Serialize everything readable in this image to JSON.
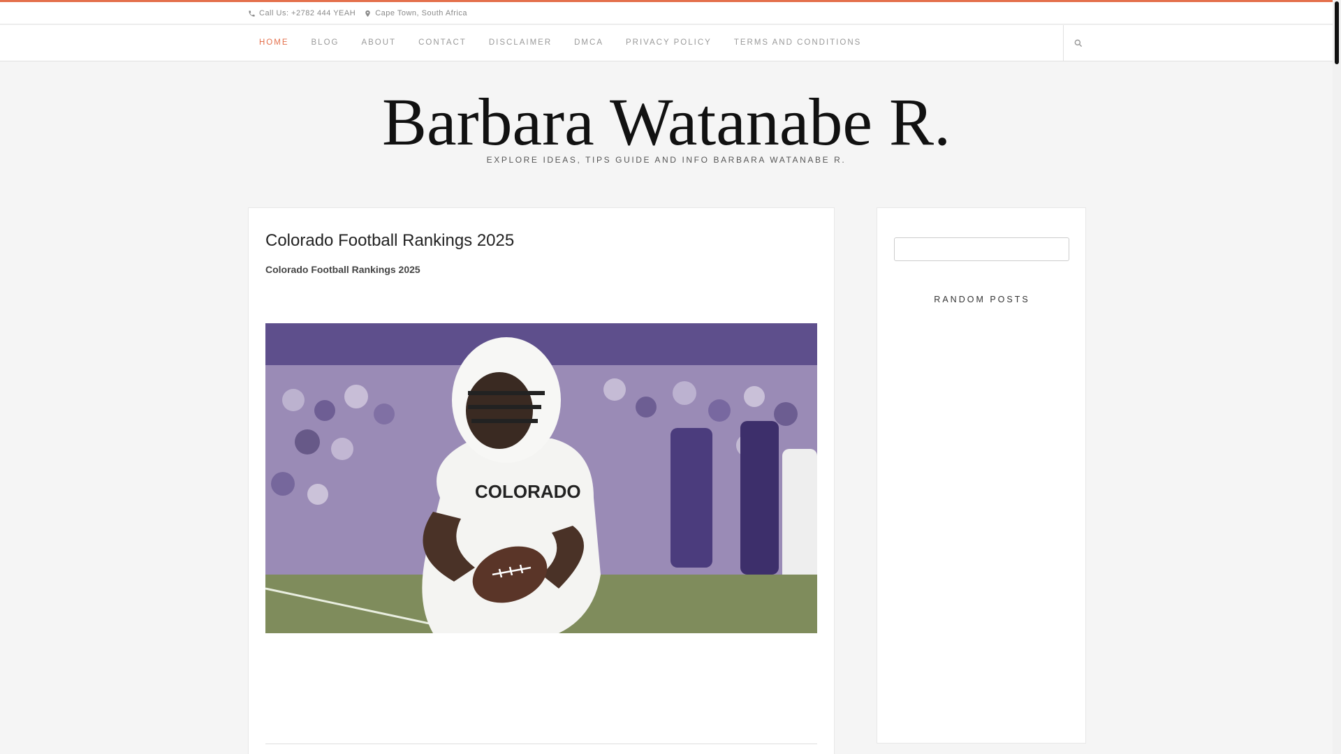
{
  "topbar": {
    "phone": "Call Us: +2782 444 YEAH",
    "location": "Cape Town, South Africa"
  },
  "nav": {
    "items": [
      {
        "label": "HOME",
        "active": true
      },
      {
        "label": "BLOG"
      },
      {
        "label": "ABOUT"
      },
      {
        "label": "CONTACT"
      },
      {
        "label": "DISCLAIMER"
      },
      {
        "label": "DMCA"
      },
      {
        "label": "PRIVACY POLICY"
      },
      {
        "label": "TERMS AND CONDITIONS"
      }
    ],
    "search_icon": "search-icon"
  },
  "header": {
    "title": "Barbara Watanabe R.",
    "tagline": "EXPLORE IDEAS, TIPS GUIDE AND INFO BARBARA WATANABE R."
  },
  "post": {
    "title": "Colorado Football Rankings 2025",
    "subtitle": "Colorado Football Rankings 2025"
  },
  "sidebar": {
    "search_value": "",
    "widget_title": "RANDOM POSTS"
  },
  "colors": {
    "accent": "#e4704c",
    "background": "#f5f5f5"
  }
}
